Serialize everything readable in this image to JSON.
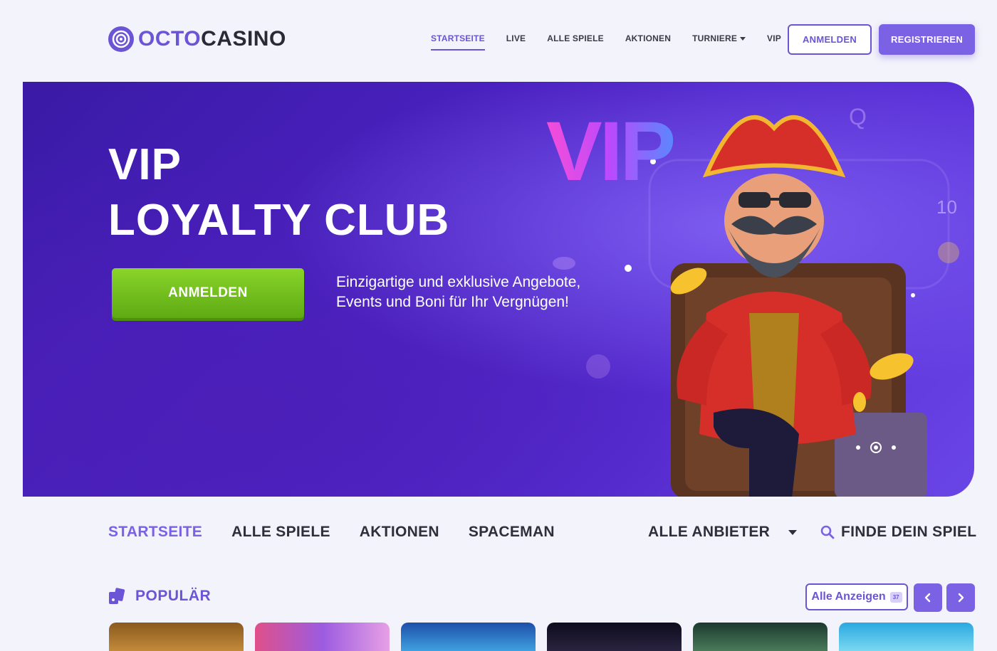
{
  "header": {
    "logo": {
      "octo": "OCTO",
      "casino": "CASINO"
    },
    "nav": [
      {
        "label": "STARTSEITE",
        "active": true
      },
      {
        "label": "LIVE",
        "active": false
      },
      {
        "label": "ALLE SPIELE",
        "active": false
      },
      {
        "label": "AKTIONEN",
        "active": false
      },
      {
        "label": "TURNIERE",
        "active": false,
        "has_dropdown": true
      },
      {
        "label": "VIP",
        "active": false
      }
    ],
    "login_label": "ANMELDEN",
    "register_label": "REGISTRIEREN"
  },
  "hero": {
    "title_line1": "VIP",
    "title_line2": "LOYALTY CLUB",
    "cta_label": "ANMELDEN",
    "description_line1": "Einzigartige und exklusive Angebote,",
    "description_line2": "Events und Boni für Ihr Vergnügen!",
    "art_text": "VIP",
    "carousel": {
      "slides": 3,
      "active_index": 1
    }
  },
  "subnav": {
    "items": [
      {
        "label": "STARTSEITE",
        "active": true
      },
      {
        "label": "ALLE SPIELE",
        "active": false
      },
      {
        "label": "AKTIONEN",
        "active": false
      },
      {
        "label": "SPACEMAN",
        "active": false
      }
    ],
    "providers_label": "ALLE ANBIETER",
    "search_label": "FINDE DEIN SPIEL"
  },
  "popular": {
    "title": "POPULÄR",
    "view_all_label": "Alle Anzeigen",
    "count": "37"
  },
  "colors": {
    "accent": "#6c54d6",
    "cta_green": "#7cc41f",
    "background": "#f3f3fb"
  }
}
